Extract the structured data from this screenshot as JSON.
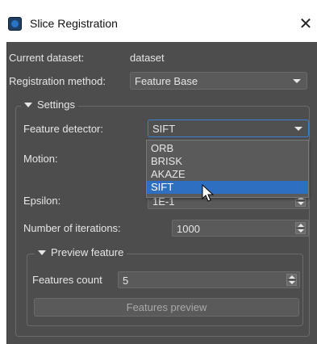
{
  "window": {
    "title": "Slice Registration",
    "close_icon": "close-icon",
    "app_icon": "app-icon"
  },
  "form": {
    "dataset_label": "Current dataset:",
    "dataset_value": "dataset",
    "method_label": "Registration method:",
    "method_value": "Feature Base"
  },
  "settings": {
    "title": "Settings",
    "detector_label": "Feature detector:",
    "detector_value": "SIFT",
    "detector_options": [
      "ORB",
      "BRISK",
      "AKAZE",
      "SIFT"
    ],
    "motion_label": "Motion:",
    "epsilon_label": "Epsilon:",
    "epsilon_value": "1E-1",
    "iterations_label": "Number of iterations:",
    "iterations_value": "1000"
  },
  "preview": {
    "title": "Preview feature",
    "count_label": "Features count",
    "count_value": "5",
    "button_label": "Features preview"
  },
  "colors": {
    "panel": "#4d4d4d",
    "accent": "#2e6fc2",
    "text": "#e6e6e6"
  }
}
